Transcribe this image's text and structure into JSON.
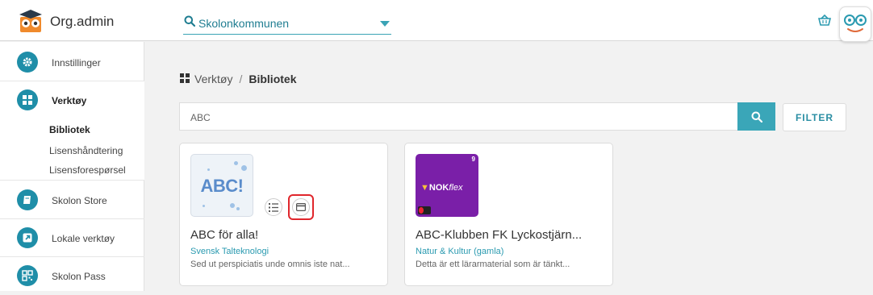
{
  "header": {
    "app_title": "Org.admin",
    "org_select_value": "Skolonkommunen"
  },
  "sidebar": {
    "items": [
      {
        "label": "Innstillinger",
        "icon": "gear-icon"
      },
      {
        "label": "Verktøy",
        "icon": "grid-icon"
      },
      {
        "label": "Skolon Store",
        "icon": "book-icon"
      },
      {
        "label": "Lokale verktøy",
        "icon": "external-link-icon"
      },
      {
        "label": "Skolon Pass",
        "icon": "qr-icon"
      }
    ],
    "subitems": [
      "Bibliotek",
      "Lisenshåndtering",
      "Lisensforespørsel"
    ]
  },
  "breadcrumb": {
    "parent": "Verktøy",
    "separator": "/",
    "current": "Bibliotek"
  },
  "search": {
    "query": "ABC",
    "filter_label": "FILTER"
  },
  "cards": [
    {
      "title": "ABC för alla!",
      "publisher": "Svensk Talteknologi",
      "description": "Sed ut perspiciatis unde omnis iste nat...",
      "thumb_text": "ABC!"
    },
    {
      "title": "ABC-Klubben FK Lyckostjärn...",
      "publisher": "Natur & Kultur (gamla)",
      "description": "Detta är ett lärarmaterial som är tänkt...",
      "thumb_brand": "NOK",
      "thumb_brand_suffix": "flex",
      "thumb_grade": "9"
    }
  ],
  "colors": {
    "accent": "#3aa6b8",
    "sidebar_icon": "#1f8ea8",
    "highlight": "#e0262c",
    "nok_purple": "#7a1fa8"
  }
}
